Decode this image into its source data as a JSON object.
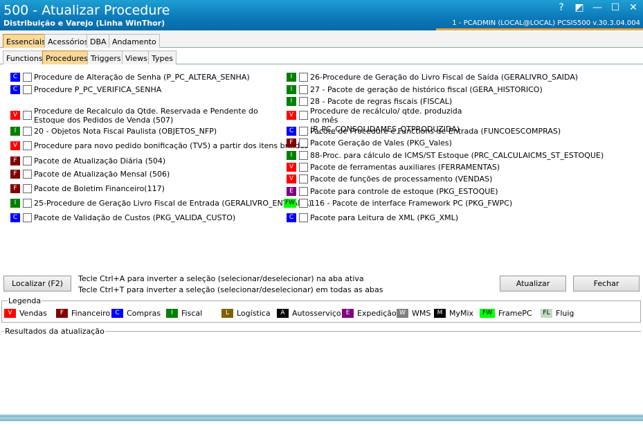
{
  "window": {
    "title": "500 - Atualizar Procedure",
    "subtitle": "Distribuição e Varejo (Linha WinThor)",
    "connection": "1 - PCADMIN (LOCAL@LOCAL)   PCSIS500  v.30.3.04.004",
    "controls": [
      "?",
      "◩",
      "—",
      "☐",
      "✕"
    ]
  },
  "main_tabs": [
    {
      "label": "Essenciais",
      "active": true
    },
    {
      "label": "Acessórios"
    },
    {
      "label": "DBA"
    },
    {
      "label": "Andamento"
    }
  ],
  "sub_tabs": [
    {
      "label": "Functions"
    },
    {
      "label": "Procedures",
      "active": true
    },
    {
      "label": "Triggers"
    },
    {
      "label": "Views"
    },
    {
      "label": "Types"
    }
  ],
  "colors": {
    "V": "#ff0000",
    "F": "#800000",
    "C": "#0000ff",
    "I": "#008000",
    "L": "#806000",
    "A": "#000000",
    "E": "#800080",
    "W": "#808080",
    "M": "#000000",
    "FW": "#00ff00",
    "FL": "#c0dcc0"
  },
  "left_items": [
    {
      "badge": "C",
      "label": "Procedure de Alteração de Senha (P_PC_ALTERA_SENHA)"
    },
    {
      "badge": "C",
      "label": "Procedure P_PC_VERIFICA_SENHA"
    },
    {
      "badge": "V",
      "label": "Procedure de Recalculo da Qtde. Reservada e Pendente do Estoque dos Pedidos de Venda (507)"
    },
    {
      "badge": "I",
      "label": "20 - Objetos Nota Fiscal Paulista (OBJETOS_NFP)"
    },
    {
      "badge": "V",
      "label": "Procedure para novo pedido bonificação (TV5) a partir dos itens brindes"
    },
    {
      "badge": "F",
      "label": "Pacote de Atualização Diária (504)"
    },
    {
      "badge": "F",
      "label": "Pacote de Atualização Mensal (506)"
    },
    {
      "badge": "F",
      "label": "Pacote de Boletim Financeiro(117)"
    },
    {
      "badge": "I",
      "label": "25-Procedure de Geração Livro Fiscal de Entrada (GERALIVRO_ENTRADA)"
    },
    {
      "badge": "C",
      "label": "Pacote de Validação de Custos (PKG_VALIDA_CUSTO)"
    }
  ],
  "right_items": [
    {
      "badge": "I",
      "label": "26-Procedure de Geração do Livro Fiscal de Saída (GERALIVRO_SAIDA)"
    },
    {
      "badge": "I",
      "label": "27 - Pacote de geração de histórico fiscal (GERA_HISTORICO)"
    },
    {
      "badge": "I",
      "label": "28 - Pacote de regras fiscais (FISCAL)"
    },
    {
      "badge": "V",
      "label": "Procedure de recálculo/ qtde. produzida no mês (P_PC_CONSOLIDAMES_QTPRODUZIDA)"
    },
    {
      "badge": "C",
      "label": "Pacote de Procedure e Functions de Entrada (FUNCOESCOMPRAS)"
    },
    {
      "badge": "F",
      "label": "Pacote Geração de Vales (PKG_Vales)"
    },
    {
      "badge": "I",
      "label": "88-Proc. para cálculo de ICMS/ST Estoque (PRC_CALCULAICMS_ST_ESTOQUE)"
    },
    {
      "badge": "V",
      "label": "Pacote de ferramentas auxiliares (FERRAMENTAS)"
    },
    {
      "badge": "V",
      "label": "Pacote de funções de processamento (VENDAS)"
    },
    {
      "badge": "E",
      "label": "Pacote para controle de estoque (PKG_ESTOQUE)"
    },
    {
      "badge": "FW",
      "label": "116 - Pacote de interface Framework PC (PKG_FWPC)"
    },
    {
      "badge": "C",
      "label": "Pacote para Leitura de XML (PKG_XML)"
    }
  ],
  "buttons": {
    "localizar": "Localizar (F2)",
    "atualizar": "Atualizar",
    "fechar": "Fechar"
  },
  "hints": [
    "Tecle Ctrl+A para inverter a seleção (selecionar/deselecionar) na aba ativa",
    "Tecle Ctrl+T para inverter a seleção (selecionar/deselecionar) em todas as abas"
  ],
  "legend": {
    "title": "Legenda",
    "items": [
      {
        "badge": "V",
        "label": "Vendas"
      },
      {
        "badge": "F",
        "label": "Financeiro"
      },
      {
        "badge": "C",
        "label": "Compras"
      },
      {
        "badge": "I",
        "label": "Fiscal"
      },
      {
        "badge": "L",
        "label": "Logística"
      },
      {
        "badge": "A",
        "label": "Autosserviço"
      },
      {
        "badge": "E",
        "label": "Expedição"
      },
      {
        "badge": "W",
        "label": "WMS"
      },
      {
        "badge": "M",
        "label": "MyMix"
      },
      {
        "badge": "FW",
        "label": "FramePC"
      },
      {
        "badge": "FL",
        "label": "Fluig"
      }
    ]
  },
  "results": {
    "title": "Resultados da atualização"
  }
}
